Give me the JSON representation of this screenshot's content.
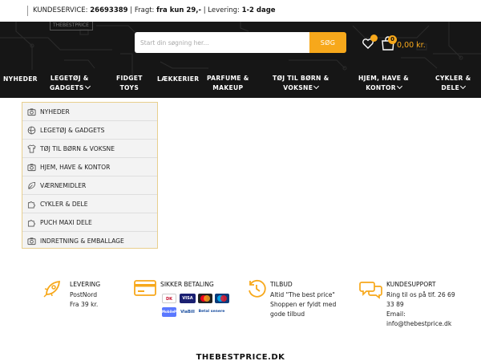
{
  "topbar": {
    "service_label": "KUNDESERVICE:",
    "service_phone": "26693389",
    "freight_text": "| Fragt:",
    "freight_value": "fra kun 29,-",
    "delivery_text": "| Levering:",
    "delivery_value": "1-2 dage"
  },
  "header": {
    "logo_fragment": "THEBESTPRICE",
    "search_placeholder": "Start din søgning her...",
    "search_button": "SØG",
    "cart_count": "0",
    "cart_total": "0,00 kr.",
    "accent": "#f7a81b",
    "background": "#161616"
  },
  "nav": [
    {
      "line1": "NYHEDER",
      "line2": ""
    },
    {
      "line1": "LEGETØJ &",
      "line2": "GADGETS"
    },
    {
      "line1": "FIDGET",
      "line2": "TOYS"
    },
    {
      "line1": "LÆKKERIER",
      "line2": ""
    },
    {
      "line1": "PARFUME &",
      "line2": "MAKEUP"
    },
    {
      "line1": "TØJ TIL BØRN &",
      "line2": "VOKSNE"
    },
    {
      "line1": "HJEM, HAVE &",
      "line2": "KONTOR"
    },
    {
      "line1": "CYKLER &",
      "line2": "DELE"
    }
  ],
  "catmenu": [
    {
      "label": "NYHEDER",
      "icon": "camera-icon"
    },
    {
      "label": "LEGETØJ & GADGETS",
      "icon": "ball-icon"
    },
    {
      "label": "TØJ TIL BØRN & VOKSNE",
      "icon": "shirt-icon"
    },
    {
      "label": "HJEM, HAVE & KONTOR",
      "icon": "camera-icon"
    },
    {
      "label": "VÆRNEMIDLER",
      "icon": "leaf-icon"
    },
    {
      "label": "CYKLER & DELE",
      "icon": "puzzle-icon"
    },
    {
      "label": "PUCH MAXI DELE",
      "icon": "puzzle-icon"
    },
    {
      "label": "INDRETNING & EMBALLAGE",
      "icon": "camera-icon"
    }
  ],
  "features": {
    "delivery": {
      "title": "LEVERING",
      "line1": "PostNord",
      "line2": "Fra 39 kr."
    },
    "payment": {
      "title": "SIKKER BETALING",
      "methods": [
        "Dankort",
        "VISA",
        "Mastercard",
        "Maestro",
        "MobilePay",
        "ViaBill",
        "Betal senere"
      ]
    },
    "offer": {
      "title": "TILBUD",
      "line1": "Altid \"The best price\"",
      "line2": "Shoppen er fyldt med",
      "line3": "gode tilbud"
    },
    "support": {
      "title": "KUNDESUPPORT",
      "line1": "Ring til os på tlf. 26 69",
      "line2": "33 89",
      "line3": "Email:",
      "line4": "info@thebestprice.dk"
    }
  },
  "footer_brand": "THEBESTPRICE.DK"
}
